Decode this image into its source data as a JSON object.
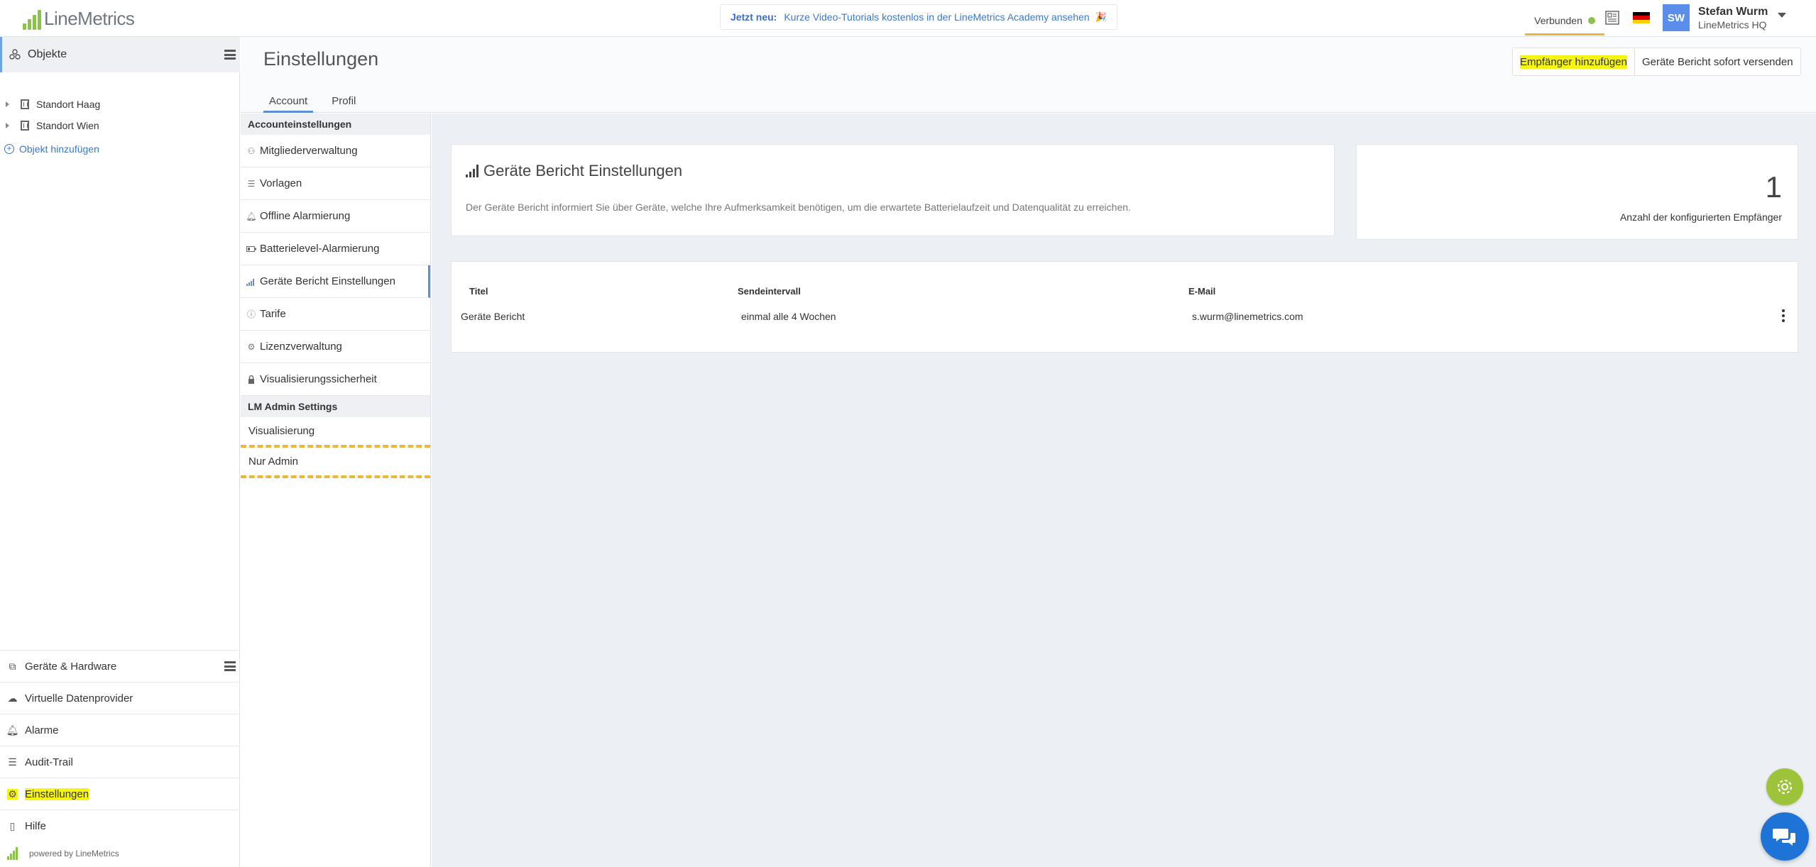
{
  "app": {
    "logo_text_line": "Line",
    "logo_text_metrics": "Metrics"
  },
  "topbar": {
    "news_label": "Jetzt neu:",
    "news_message": "Kurze Video-Tutorials kostenlos in der LineMetrics Academy ansehen",
    "news_emoji": "🎉",
    "status_label": "Verbunden",
    "status_color": "#8bc34a",
    "news_icon": "newspaper-icon",
    "flag_colors": [
      "#000000",
      "#dd0000",
      "#ffce00"
    ],
    "user_initials": "SW",
    "user_name": "Stefan Wurm",
    "user_org": "LineMetrics HQ"
  },
  "sidebar": {
    "objects_label": "Objekte",
    "tree": [
      {
        "label": "Standort Haag",
        "icon": "building-icon"
      },
      {
        "label": "Standort Wien",
        "icon": "building-icon"
      }
    ],
    "add_object_label": "Objekt hinzufügen",
    "nav": [
      {
        "label": "Geräte & Hardware",
        "icon": "device-icon"
      },
      {
        "label": "Virtuelle Datenprovider",
        "icon": "cloud-icon"
      },
      {
        "label": "Alarme",
        "icon": "bell-icon"
      },
      {
        "label": "Audit-Trail",
        "icon": "list-icon"
      },
      {
        "label": "Einstellungen",
        "icon": "gear-icon"
      },
      {
        "label": "Hilfe",
        "icon": "book-icon"
      }
    ],
    "powered_by": "powered by LineMetrics"
  },
  "header": {
    "title": "Einstellungen",
    "tabs": [
      {
        "label": "Account",
        "active": true
      },
      {
        "label": "Profil",
        "active": false
      }
    ],
    "add_recipient_label": "Empfänger hinzufügen",
    "send_report_label": "Geräte Bericht sofort versenden"
  },
  "settings_menu": {
    "section_account": "Accounteinstellungen",
    "items": [
      {
        "label": "Mitgliederverwaltung",
        "icon": "users-icon"
      },
      {
        "label": "Vorlagen",
        "icon": "list-icon"
      },
      {
        "label": "Offline Alarmierung",
        "icon": "bell-icon"
      },
      {
        "label": "Batterielevel-Alarmierung",
        "icon": "battery-icon"
      },
      {
        "label": "Geräte Bericht Einstellungen",
        "icon": "signal-icon",
        "active": true
      },
      {
        "label": "Tarife",
        "icon": "info-icon"
      },
      {
        "label": "Lizenzverwaltung",
        "icon": "gear-icon"
      },
      {
        "label": "Visualisierungssicherheit",
        "icon": "lock-icon"
      }
    ],
    "section_admin": "LM Admin Settings",
    "admin_items": [
      {
        "label": "Visualisierung"
      },
      {
        "label": "Nur Admin"
      }
    ]
  },
  "report": {
    "title": "Geräte Bericht Einstellungen",
    "description": "Der Geräte Bericht informiert Sie über Geräte, welche Ihre Aufmerksamkeit benötigen, um die erwartete Batterielaufzeit und Datenqualität zu erreichen.",
    "count": "1",
    "count_label": "Anzahl der konfigurierten Empfänger",
    "columns": [
      "Titel",
      "Sendeintervall",
      "E-Mail"
    ],
    "rows": [
      {
        "title": "Geräte Bericht",
        "interval": "einmal alle 4 Wochen",
        "email": "s.wurm@linemetrics.com"
      }
    ]
  },
  "colors": {
    "accent": "#5a8fd6",
    "brand_green": "#8bc34a",
    "highlight": "#f5f511",
    "chat_blue": "#1e74d6"
  }
}
